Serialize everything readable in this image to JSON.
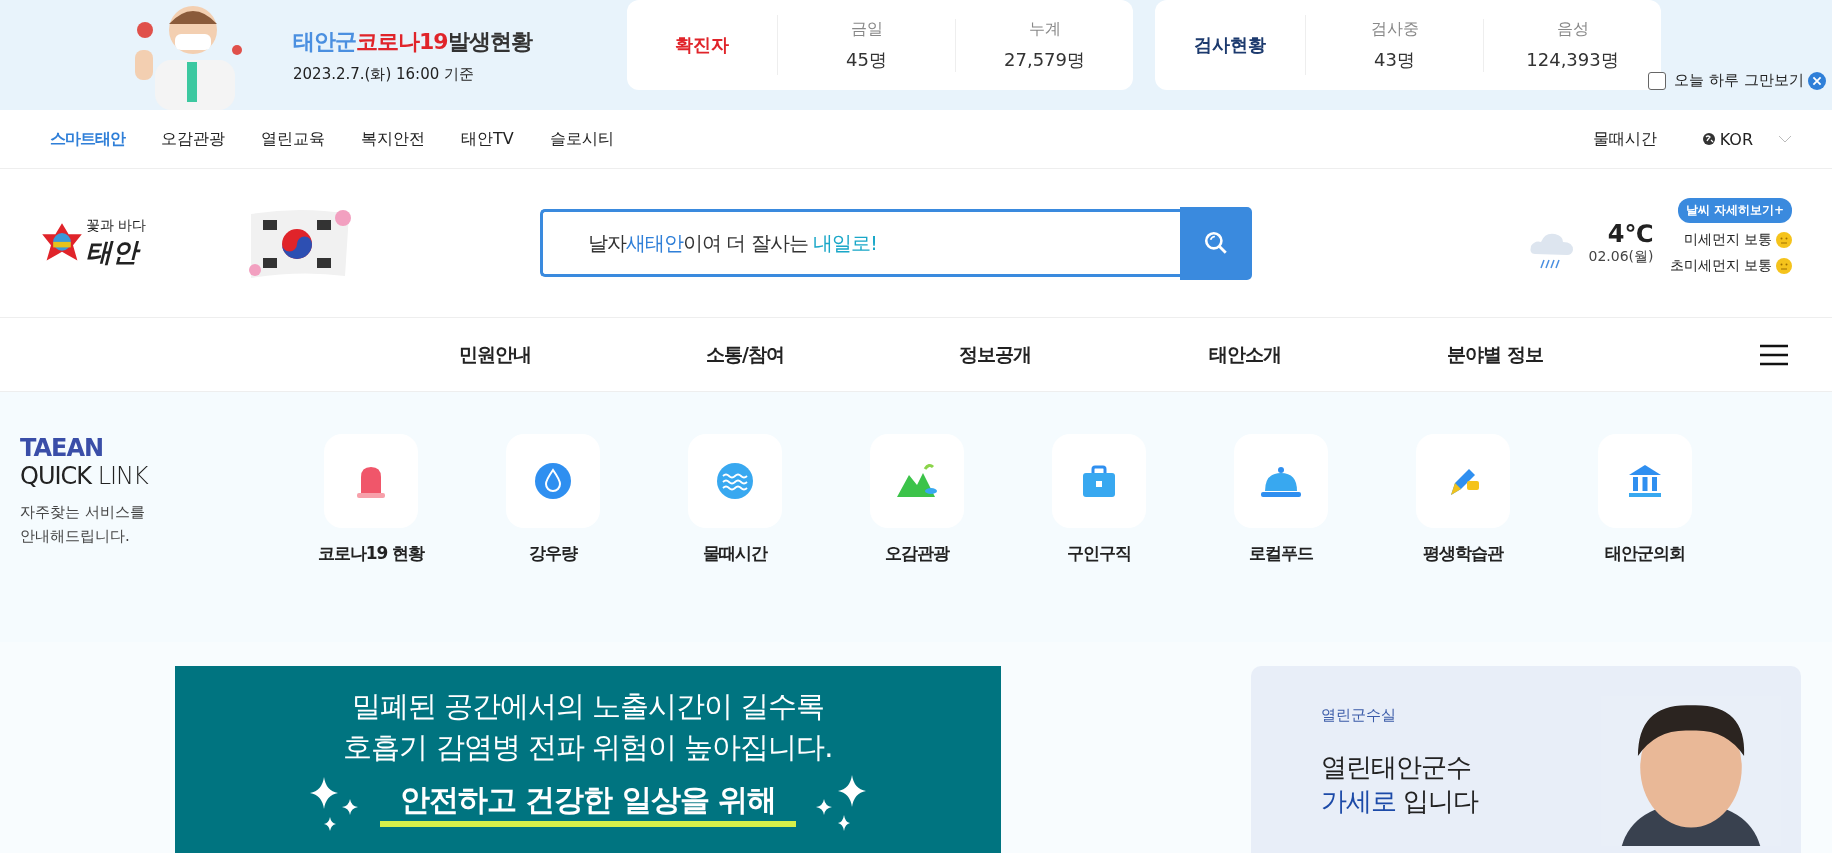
{
  "covid_banner": {
    "title_parts": [
      {
        "text": "태안군",
        "color": "#4a8fe0"
      },
      {
        "text": "코로나19",
        "color": "#e0242a"
      },
      {
        "text": "발생현황",
        "color": "#333333"
      }
    ],
    "date": "2023.2.7.(화) 16:00 기준",
    "cards": [
      {
        "label": "확진자",
        "color": "#e0242a",
        "stats": [
          {
            "name": "금일",
            "value": "45명"
          },
          {
            "name": "누계",
            "value": "27,579명"
          }
        ]
      },
      {
        "label": "검사현황",
        "color": "#1c3a6e",
        "stats": [
          {
            "name": "검사중",
            "value": "43명"
          },
          {
            "name": "음성",
            "value": "124,393명"
          }
        ]
      }
    ],
    "hide_today": {
      "label": "오늘 하루 그만보기",
      "checked": false
    }
  },
  "top_nav": {
    "items": [
      {
        "label": "스마트태안",
        "selected": true
      },
      {
        "label": "오감관광",
        "selected": false
      },
      {
        "label": "열린교육",
        "selected": false
      },
      {
        "label": "복지안전",
        "selected": false
      },
      {
        "label": "태안TV",
        "selected": false
      },
      {
        "label": "슬로시티",
        "selected": false
      }
    ],
    "tide_link": "물때시간",
    "language": "KOR"
  },
  "header": {
    "logo_slogan": "꽃과 바다",
    "logo_name": "태안",
    "search": {
      "placeholder_parts": [
        {
          "text": "날자",
          "color": "#333333"
        },
        {
          "text": "새태안",
          "color": "#2f7fd8"
        },
        {
          "text": "이여 더 잘사는 ",
          "color": "#333333"
        },
        {
          "text": "내일로!",
          "color": "#1aa7c8"
        }
      ]
    },
    "weather": {
      "temperature": "4℃",
      "date": "02.06(월)",
      "detail_button": "날씨 자세히보기+",
      "air": [
        {
          "label": "미세먼지 보통",
          "color": "#f5c31c"
        },
        {
          "label": "초미세먼지 보통",
          "color": "#f5c31c"
        }
      ]
    }
  },
  "main_menu": [
    "민원안내",
    "소통/참여",
    "정보공개",
    "태안소개",
    "분야별 정보"
  ],
  "quick_link": {
    "title_top": "TAEAN",
    "title_bold": "QUICK",
    "title_light": "LINK",
    "description": [
      "자주찾는 서비스를",
      "안내해드립니다."
    ],
    "items": [
      {
        "kind": "siren",
        "label": "코로나19 현황"
      },
      {
        "kind": "drop",
        "label": "강우량"
      },
      {
        "kind": "wave",
        "label": "물때시간"
      },
      {
        "kind": "mountain",
        "label": "오감관광"
      },
      {
        "kind": "briefcase",
        "label": "구인구직"
      },
      {
        "kind": "cloche",
        "label": "로컬푸드"
      },
      {
        "kind": "pen",
        "label": "평생학습관"
      },
      {
        "kind": "building",
        "label": "태안군의회"
      }
    ]
  },
  "notice_banner": {
    "lines": [
      "밀폐된 공간에서의 노출시간이 길수록",
      "호흡기 감염병 전파 위험이 높아집니다."
    ],
    "highlight": "안전하고 건강한 일상을 위해"
  },
  "mayor_card": {
    "section": "열린군수실",
    "line1": "열린태안군수",
    "name": "가세로",
    "suffix": "입니다"
  }
}
